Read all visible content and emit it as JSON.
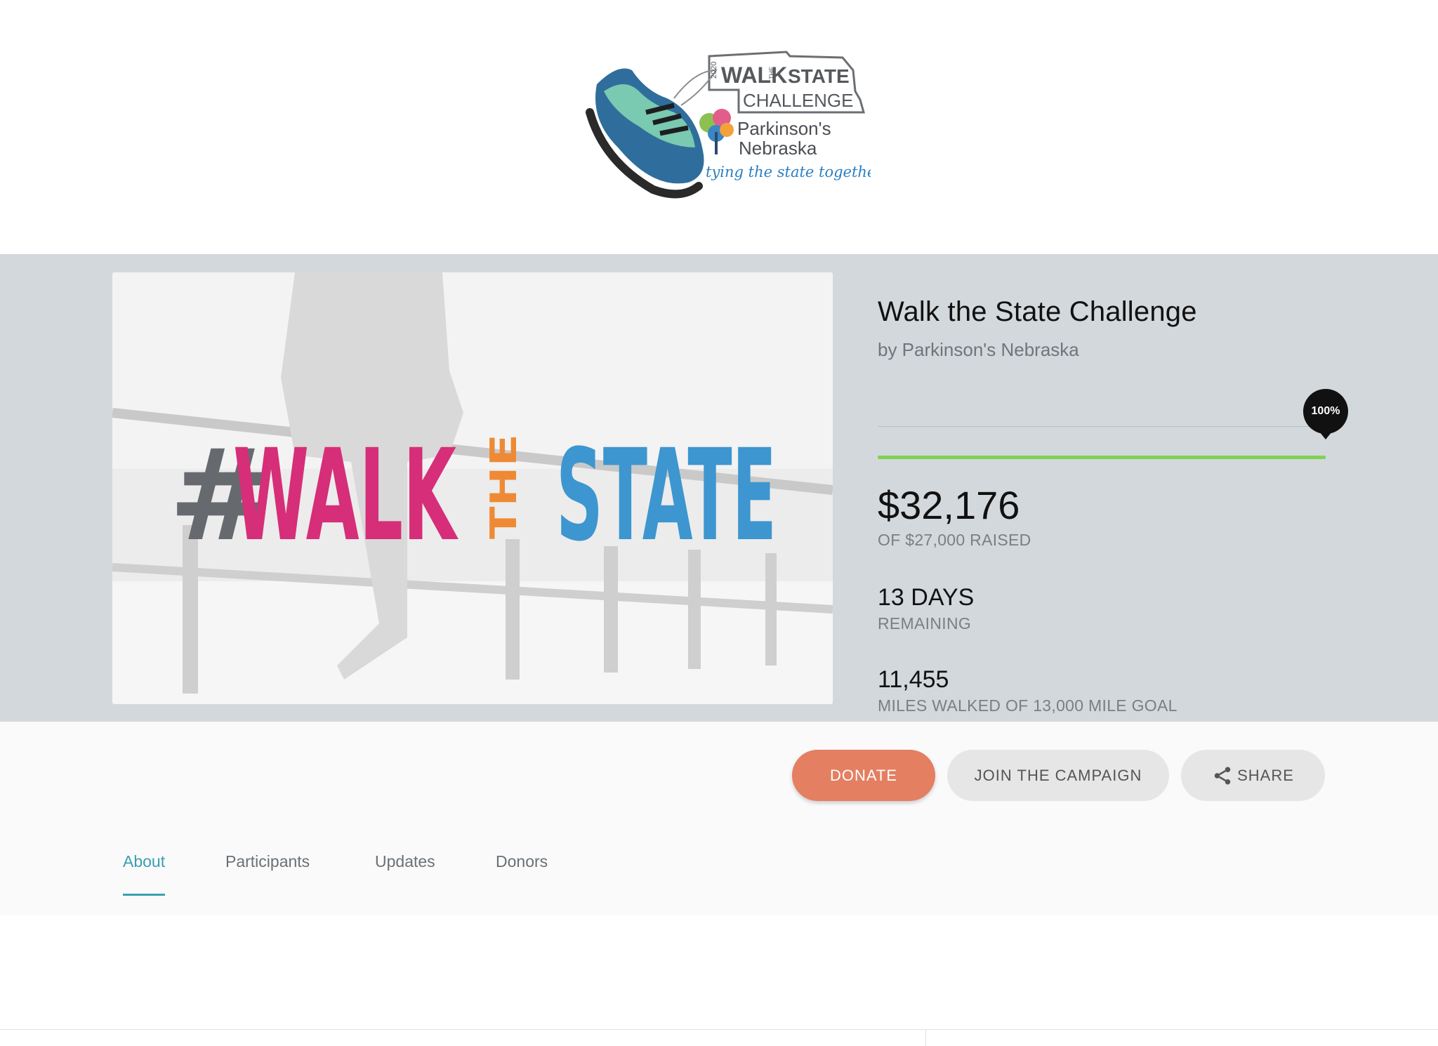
{
  "logo": {
    "year": "2020",
    "walk": "WALK",
    "the": "THE",
    "state": "STATE",
    "challenge": "CHALLENGE",
    "org_line1": "Parkinson's",
    "org_line2": "Nebraska",
    "tagline": "tying the state together"
  },
  "hero": {
    "hashtag_symbol": "#",
    "hashtag_walk": "WALK",
    "hashtag_the": "THE",
    "hashtag_state": "STATE"
  },
  "campaign": {
    "title": "Walk the State Challenge",
    "organizer": "by Parkinson's Nebraska",
    "progress_percent": 100,
    "progress_label": "100%",
    "raised_amount": "$32,176",
    "raised_label": "OF $27,000 RAISED",
    "days_value": "13 DAYS",
    "days_label": "REMAINING",
    "miles_value": "11,455",
    "miles_label": "MILES WALKED OF 13,000 MILE GOAL"
  },
  "actions": {
    "donate_label": "DONATE",
    "join_label": "JOIN THE CAMPAIGN",
    "share_label": "SHARE"
  },
  "tabs": [
    {
      "label": "About",
      "active": true
    },
    {
      "label": "Participants",
      "active": false
    },
    {
      "label": "Updates",
      "active": false
    },
    {
      "label": "Donors",
      "active": false
    }
  ],
  "colors": {
    "accent_teal": "#3a9fb2",
    "donate": "#e47f61",
    "progress": "#7ed352",
    "hashtag_pink": "#d62e78",
    "hashtag_orange": "#ee8a35",
    "hashtag_blue": "#3d96cf",
    "hashtag_gray": "#666a6e"
  }
}
